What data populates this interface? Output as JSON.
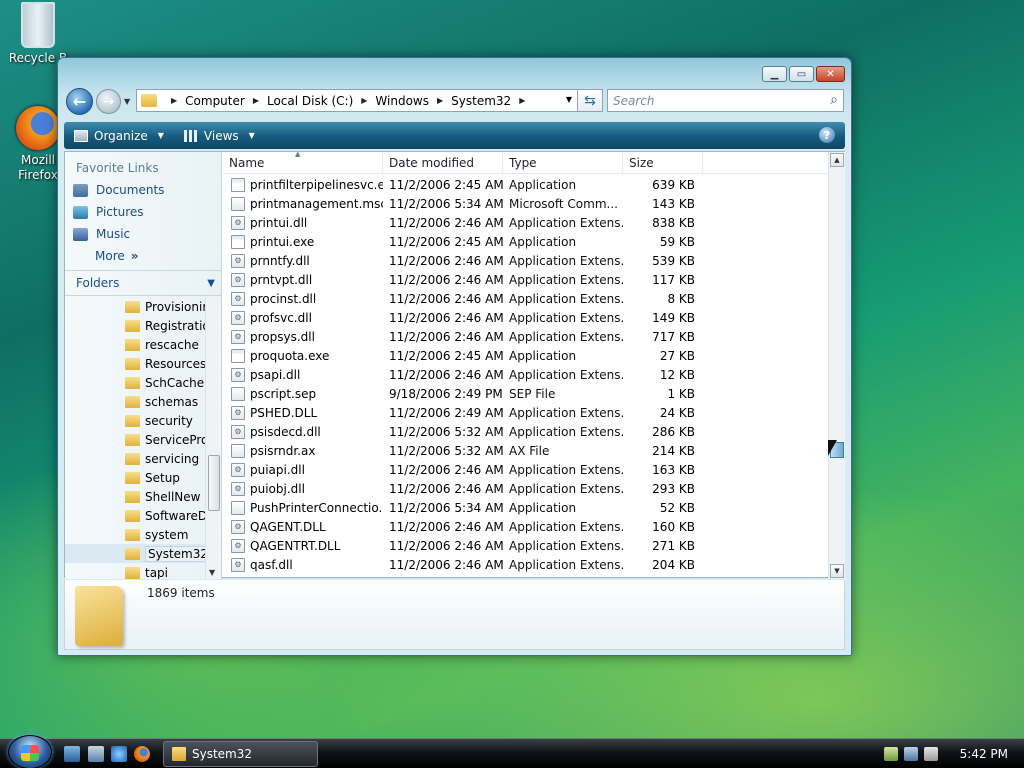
{
  "desktop": {
    "recycle_label": "Recycle B",
    "firefox_label_1": "Mozill",
    "firefox_label_2": "Firefox"
  },
  "window": {
    "address": {
      "crumbs": [
        "Computer",
        "Local Disk (C:)",
        "Windows",
        "System32"
      ]
    },
    "search_placeholder": "Search",
    "toolbar": {
      "organize": "Organize",
      "views": "Views",
      "help": "?"
    },
    "nav": {
      "favorite_links_title": "Favorite Links",
      "favorites": [
        "Documents",
        "Pictures",
        "Music"
      ],
      "more": "More",
      "more_chevron": "»",
      "folders_title": "Folders"
    },
    "tree": [
      "Provisionir",
      "Registratio",
      "rescache",
      "Resources",
      "SchCache",
      "schemas",
      "security",
      "ServiceProf",
      "servicing",
      "Setup",
      "ShellNew",
      "SoftwareDi",
      "system",
      "System32",
      "tapi"
    ],
    "columns": {
      "name": "Name",
      "date": "Date modified",
      "type": "Type",
      "size": "Size"
    },
    "files": [
      {
        "name": "printfilterpipelinesvc.exe",
        "date": "11/2/2006 2:45 AM",
        "type": "Application",
        "size": "639 KB"
      },
      {
        "name": "printmanagement.msc",
        "date": "11/2/2006 5:34 AM",
        "type": "Microsoft Comm...",
        "size": "143 KB"
      },
      {
        "name": "printui.dll",
        "date": "11/2/2006 2:46 AM",
        "type": "Application Extens...",
        "size": "838 KB"
      },
      {
        "name": "printui.exe",
        "date": "11/2/2006 2:45 AM",
        "type": "Application",
        "size": "59 KB"
      },
      {
        "name": "prnntfy.dll",
        "date": "11/2/2006 2:46 AM",
        "type": "Application Extens...",
        "size": "539 KB"
      },
      {
        "name": "prntvpt.dll",
        "date": "11/2/2006 2:46 AM",
        "type": "Application Extens...",
        "size": "117 KB"
      },
      {
        "name": "procinst.dll",
        "date": "11/2/2006 2:46 AM",
        "type": "Application Extens...",
        "size": "8 KB"
      },
      {
        "name": "profsvc.dll",
        "date": "11/2/2006 2:46 AM",
        "type": "Application Extens...",
        "size": "149 KB"
      },
      {
        "name": "propsys.dll",
        "date": "11/2/2006 2:46 AM",
        "type": "Application Extens...",
        "size": "717 KB"
      },
      {
        "name": "proquota.exe",
        "date": "11/2/2006 2:45 AM",
        "type": "Application",
        "size": "27 KB"
      },
      {
        "name": "psapi.dll",
        "date": "11/2/2006 2:46 AM",
        "type": "Application Extens...",
        "size": "12 KB"
      },
      {
        "name": "pscript.sep",
        "date": "9/18/2006 2:49 PM",
        "type": "SEP File",
        "size": "1 KB"
      },
      {
        "name": "PSHED.DLL",
        "date": "11/2/2006 2:49 AM",
        "type": "Application Extens...",
        "size": "24 KB"
      },
      {
        "name": "psisdecd.dll",
        "date": "11/2/2006 5:32 AM",
        "type": "Application Extens...",
        "size": "286 KB"
      },
      {
        "name": "psisrndr.ax",
        "date": "11/2/2006 5:32 AM",
        "type": "AX File",
        "size": "214 KB"
      },
      {
        "name": "puiapi.dll",
        "date": "11/2/2006 2:46 AM",
        "type": "Application Extens...",
        "size": "163 KB"
      },
      {
        "name": "puiobj.dll",
        "date": "11/2/2006 2:46 AM",
        "type": "Application Extens...",
        "size": "293 KB"
      },
      {
        "name": "PushPrinterConnectio...",
        "date": "11/2/2006 5:34 AM",
        "type": "Application",
        "size": "52 KB"
      },
      {
        "name": "QAGENT.DLL",
        "date": "11/2/2006 2:46 AM",
        "type": "Application Extens...",
        "size": "160 KB"
      },
      {
        "name": "QAGENTRT.DLL",
        "date": "11/2/2006 2:46 AM",
        "type": "Application Extens...",
        "size": "271 KB"
      },
      {
        "name": "qasf.dll",
        "date": "11/2/2006 2:46 AM",
        "type": "Application Extens...",
        "size": "204 KB"
      }
    ],
    "details": {
      "item_count": "1869 items"
    }
  },
  "taskbar": {
    "task_label": "System32",
    "clock": "5:42 PM"
  },
  "colors": {
    "toolbar": "#165a7d",
    "link": "#1a4d8c"
  }
}
